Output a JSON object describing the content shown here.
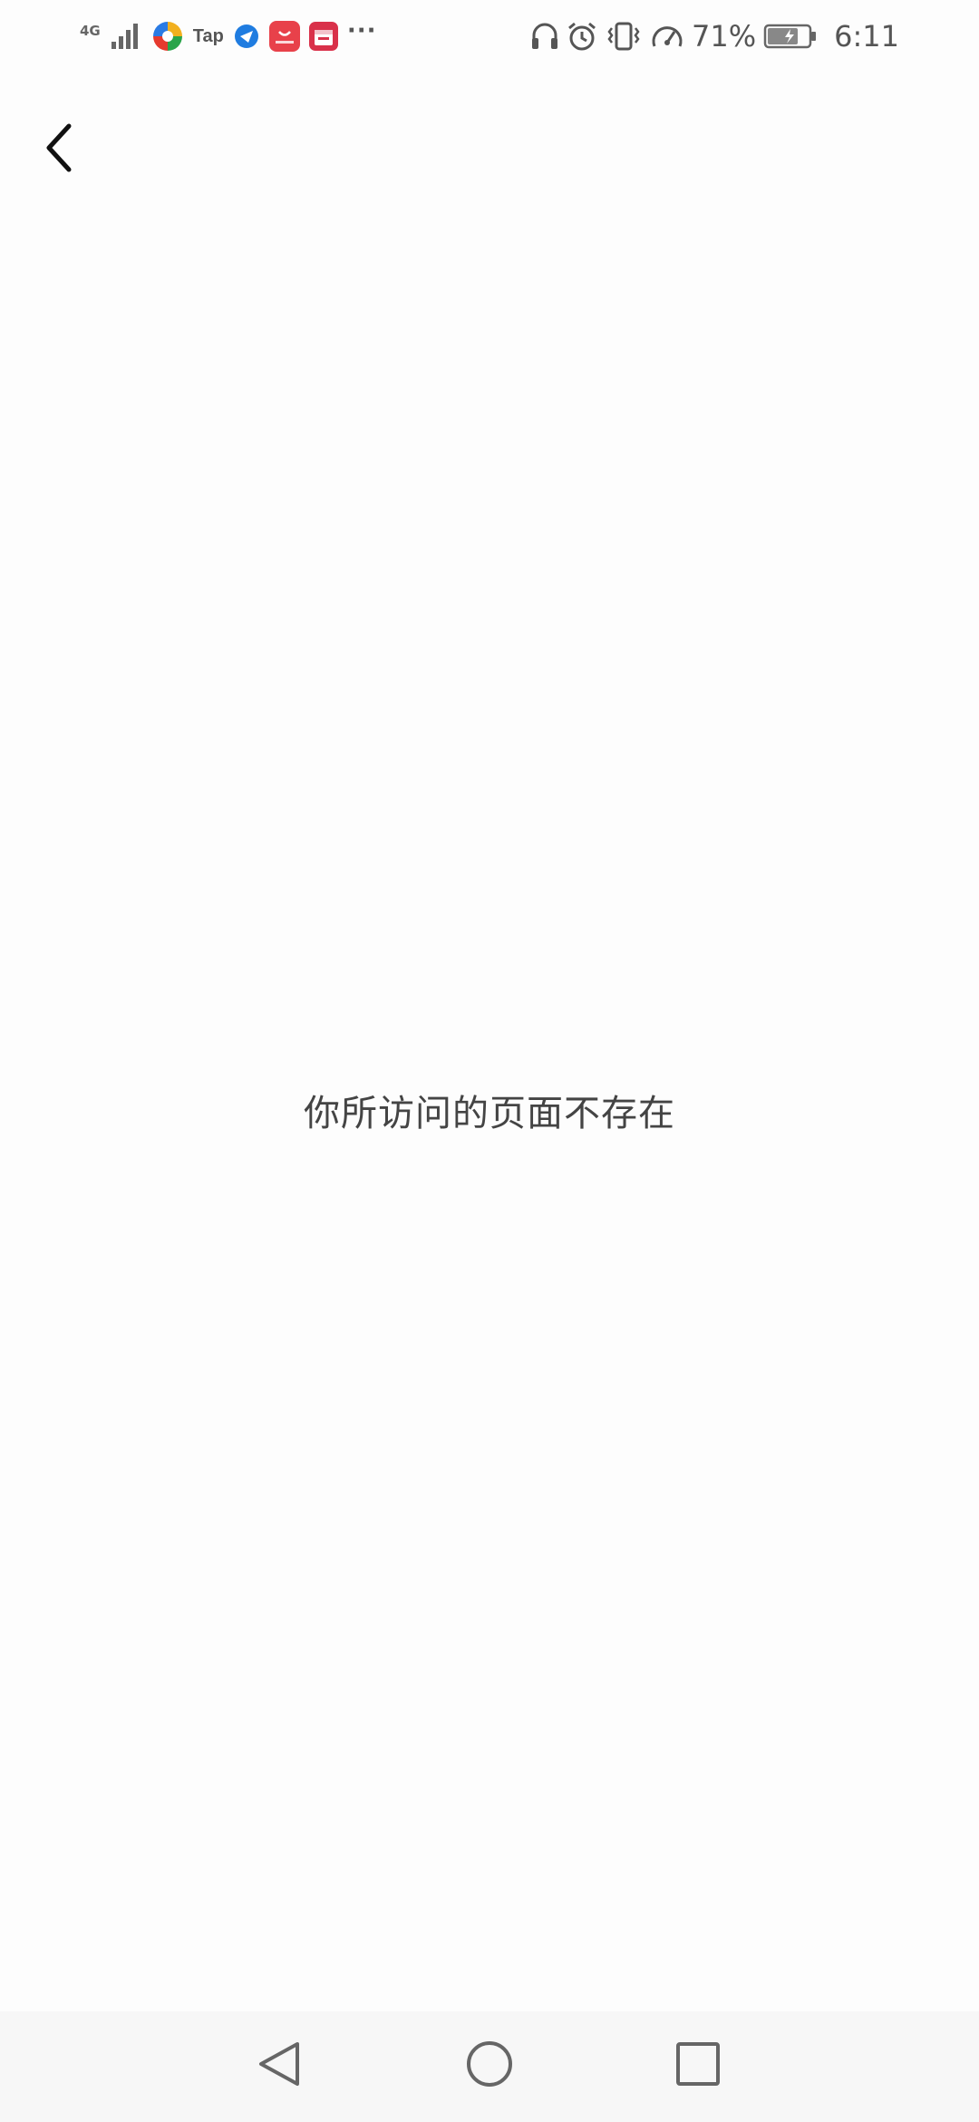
{
  "status_bar": {
    "network": "4G",
    "tap_label": "Tap",
    "more": "···",
    "battery_percent": "71%",
    "time": "6:11",
    "left_icons": [
      "signal-icon",
      "app-colorful-icon",
      "tap-icon",
      "browser-icon",
      "huawei-store-icon",
      "calendar-app-icon",
      "more-notifications-icon"
    ],
    "right_icons": [
      "headset-icon",
      "alarm-icon",
      "vibrate-icon",
      "speed-icon",
      "battery-icon"
    ]
  },
  "header": {
    "back_icon": "chevron-left-icon"
  },
  "main": {
    "message": "你所访问的页面不存在"
  },
  "nav_bar": {
    "icons": [
      "nav-back-icon",
      "nav-home-icon",
      "nav-recent-icon"
    ]
  },
  "colors": {
    "background": "#fdfdfd",
    "text": "#444444",
    "status": "#555555",
    "nav_bar": "#f7f7f7",
    "huawei_red": "#e8414a",
    "calendar_red": "#d9314a"
  }
}
